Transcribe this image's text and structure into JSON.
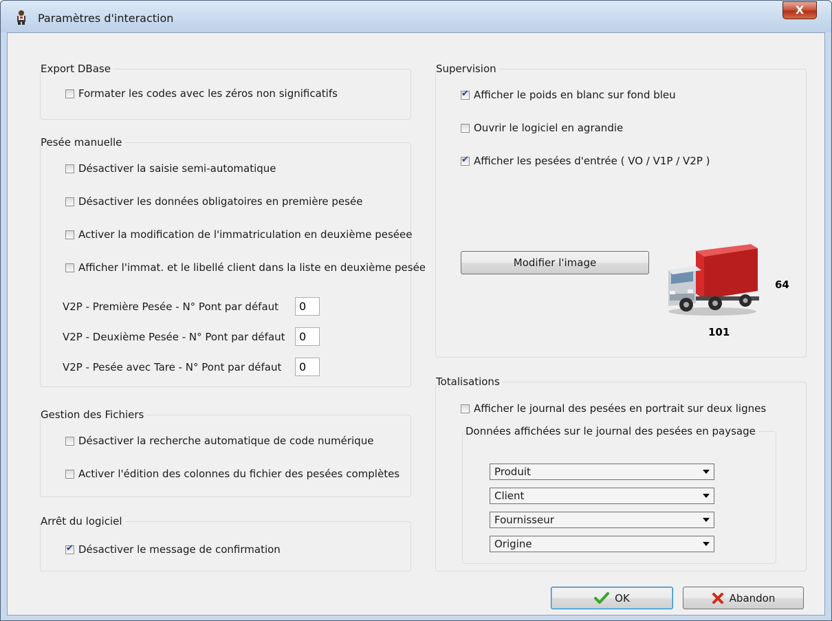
{
  "window": {
    "title": "Paramètres d'interaction",
    "close_label": "X"
  },
  "export_dbase": {
    "title": "Export DBase",
    "format_codes": {
      "label": "Formater les codes avec les zéros non significatifs",
      "checked": false
    }
  },
  "pesee_manuelle": {
    "title": "Pesée manuelle",
    "options": [
      {
        "label": "Désactiver la saisie semi-automatique",
        "checked": false
      },
      {
        "label": "Désactiver les données obligatoires en première pesée",
        "checked": false
      },
      {
        "label": "Activer la modification de l'immatriculation en deuxième peséee",
        "checked": false
      },
      {
        "label": "Afficher l'immat. et le libellé client dans la liste en deuxième pesée",
        "checked": false
      }
    ],
    "fields": [
      {
        "label": "V2P - Première Pesée - N° Pont  par défaut",
        "value": "0"
      },
      {
        "label": "V2P - Deuxième Pesée - N° Pont  par défaut",
        "value": "0"
      },
      {
        "label": "V2P - Pesée avec Tare - N° Pont  par défaut",
        "value": "0"
      }
    ]
  },
  "gestion_fichiers": {
    "title": "Gestion des Fichiers",
    "options": [
      {
        "label": "Désactiver la recherche automatique de code numérique",
        "checked": false
      },
      {
        "label": "Activer l'édition des colonnes du fichier des pesées complètes",
        "checked": false
      }
    ]
  },
  "arret_logiciel": {
    "title": "Arrêt du logiciel",
    "confirm_message": {
      "label": "Désactiver le message de confirmation",
      "checked": true
    }
  },
  "supervision": {
    "title": "Supervision",
    "options": [
      {
        "label": "Afficher le poids en blanc sur fond bleu",
        "checked": true
      },
      {
        "label": "Ouvrir le logiciel en agrandie",
        "checked": false
      },
      {
        "label": "Afficher les pesées d'entrée ( VO / V1P / V2P )",
        "checked": true
      }
    ],
    "modify_image_label": "Modifier l'image",
    "image_width_value": "64",
    "image_height_value": "101"
  },
  "totalisations": {
    "title": "Totalisations",
    "portrait": {
      "label": "Afficher le journal des pesées en portrait sur deux lignes",
      "checked": false
    },
    "landscape_group": {
      "title": "Données affichées sur le journal des pesées en paysage",
      "selects": [
        "Produit",
        "Client",
        "Fournisseur",
        "Origine"
      ]
    }
  },
  "buttons": {
    "ok": "OK",
    "cancel": "Abandon"
  },
  "colors": {
    "titlebar": "#bcd0e8",
    "close": "#c75a3c",
    "truck_cargo": "#d42a2a",
    "check": "#1e3f91",
    "ok_icon": "#3aa52a",
    "cancel_icon": "#d32a1a"
  }
}
